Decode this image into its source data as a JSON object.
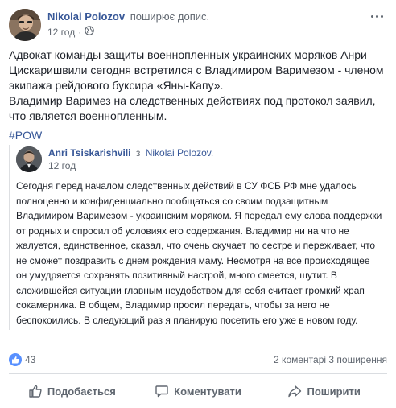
{
  "header": {
    "author": "Nikolai Polozov",
    "action": "поширює допис.",
    "time": "12 год",
    "visibility_icon": "globe-icon",
    "more_icon": "more-icon"
  },
  "post": {
    "paragraph1": "Адвокат команды защиты военнопленных украинских моряков Анри Цискаришвили сегодня встретился с Владимиром Варимезом - членом экипажа рейдового буксира «Яны-Капу».",
    "paragraph2": "Владимир Варимез на следственных действиях под протокол заявил, что является военнопленным.",
    "hashtag": "#POW"
  },
  "shared": {
    "author": "Anri Tsiskarishvili",
    "separator": "з",
    "target": "Nikolai Polozov.",
    "time": "12 год",
    "text": "Сегодня перед началом следственных действий в СУ ФСБ РФ мне удалось полноценно и конфиденциально пообщаться со своим подзащитным Владимиром Варимезом - украинским моряком. Я передал ему слова поддержки от родных и спросил об условиях его содержания. Владимир ни на что не жалуется, единственное, сказал, что очень скучает по сестре и переживает, что не сможет поздравить с днем рождения маму. Несмотря на все происходящее он умудряется сохранять позитивный настрой, много смеется, шутит. В сложившейся ситуации главным неудобством для себя считает громкий храп сокамерника. В общем, Владимир просил передать, чтобы за него не беспокоились. В следующий раз я планирую посетить его уже в новом году."
  },
  "reactions": {
    "like_count": "43",
    "comments": "2 коментарі",
    "shares": "3 поширення"
  },
  "actions": {
    "like": "Подобається",
    "comment": "Коментувати",
    "share": "Поширити"
  },
  "colors": {
    "link": "#385898",
    "meta": "#606770",
    "like_blue": "#5890ff"
  }
}
